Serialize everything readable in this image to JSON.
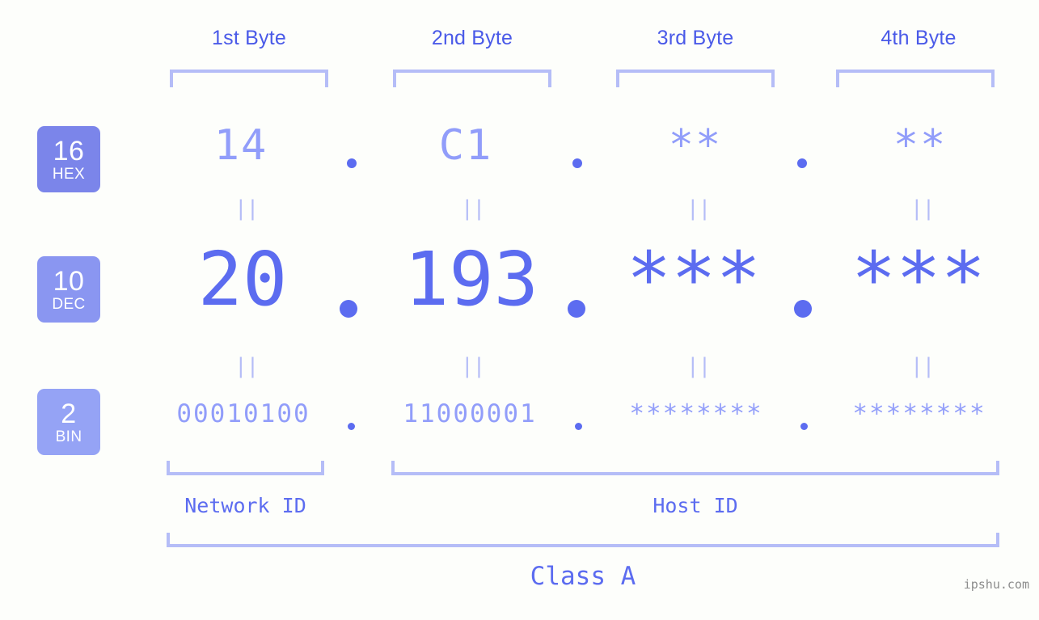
{
  "meta": {
    "watermark": "ipshu.com"
  },
  "headers": [
    {
      "label": "1st Byte"
    },
    {
      "label": "2nd Byte"
    },
    {
      "label": "3rd Byte"
    },
    {
      "label": "4th Byte"
    }
  ],
  "bases": [
    {
      "radix": "16",
      "name": "HEX",
      "color": "#7b85ea"
    },
    {
      "radix": "10",
      "name": "DEC",
      "color": "#8a96f1"
    },
    {
      "radix": "2",
      "name": "BIN",
      "color": "#95a3f5"
    }
  ],
  "rows": {
    "hex": {
      "values": [
        "14",
        "C1",
        "**",
        "**"
      ]
    },
    "dec": {
      "values": [
        "20",
        "193",
        "***",
        "***"
      ]
    },
    "bin": {
      "values": [
        "00010100",
        "11000001",
        "********",
        "********"
      ]
    }
  },
  "separators": {
    "dot": ".",
    "equals": "||"
  },
  "sections": {
    "network_id": "Network ID",
    "host_id": "Host ID",
    "class": "Class A"
  },
  "palette": {
    "background": "#fdfefb",
    "accent_strong": "#5c6cf0",
    "accent_soft": "#919dfa",
    "accent_line": "#b5bdf7",
    "header_text": "#4a5ae8",
    "watermark_text": "#8c8c8c"
  },
  "chart_data": {
    "type": "table",
    "title": "IP address 20.193.***.*** byte breakdown",
    "columns": [
      "1st Byte",
      "2nd Byte",
      "3rd Byte",
      "4th Byte"
    ],
    "rows": [
      {
        "name": "HEX",
        "radix": 16,
        "values": [
          "14",
          "C1",
          "**",
          "**"
        ]
      },
      {
        "name": "DEC",
        "radix": 10,
        "values": [
          "20",
          "193",
          "***",
          "***"
        ]
      },
      {
        "name": "BIN",
        "radix": 2,
        "values": [
          "00010100",
          "11000001",
          "********",
          "********"
        ]
      }
    ],
    "annotations": {
      "network_id_bytes": [
        1
      ],
      "host_id_bytes": [
        2,
        3,
        4
      ],
      "class": "Class A"
    }
  }
}
